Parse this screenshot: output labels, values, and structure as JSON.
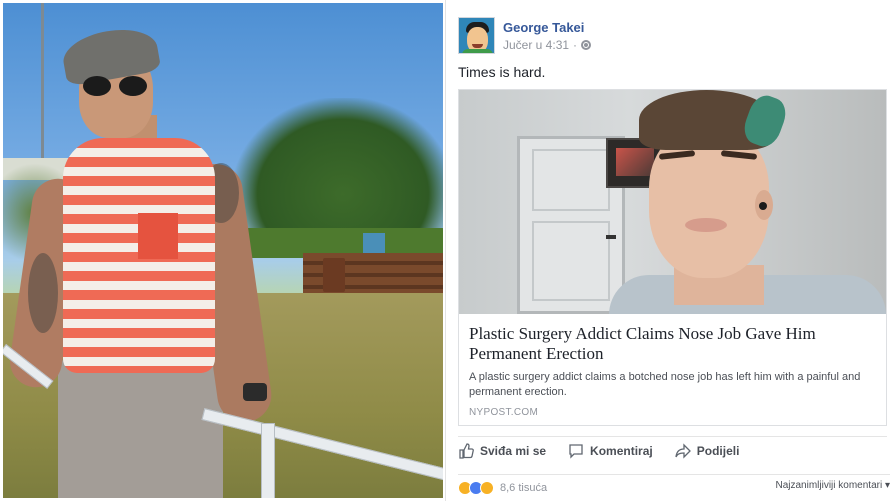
{
  "post": {
    "author": "George Takei",
    "timestamp": "Jučer u 4:31",
    "separator": "·",
    "text": "Times is hard."
  },
  "link": {
    "title": "Plastic Surgery Addict Claims Nose Job Gave Him Permanent Erection",
    "description": "A plastic surgery addict claims a botched nose job has left him with a painful and permanent erection.",
    "domain": "NYPOST.COM"
  },
  "actions": {
    "like": "Sviđa mi se",
    "comment": "Komentiraj",
    "share": "Podijeli"
  },
  "reactions": {
    "types": [
      "haha-icon",
      "like-icon",
      "wow-icon"
    ],
    "count": "8,6 tisuća"
  },
  "comments_sort": {
    "label": "Najzanimljiviji komentari",
    "arrow": "▾"
  },
  "colors": {
    "link_blue": "#365899",
    "meta_gray": "#90949c",
    "text_dark": "#1d2129",
    "like_blue": "#4a7cf0"
  }
}
